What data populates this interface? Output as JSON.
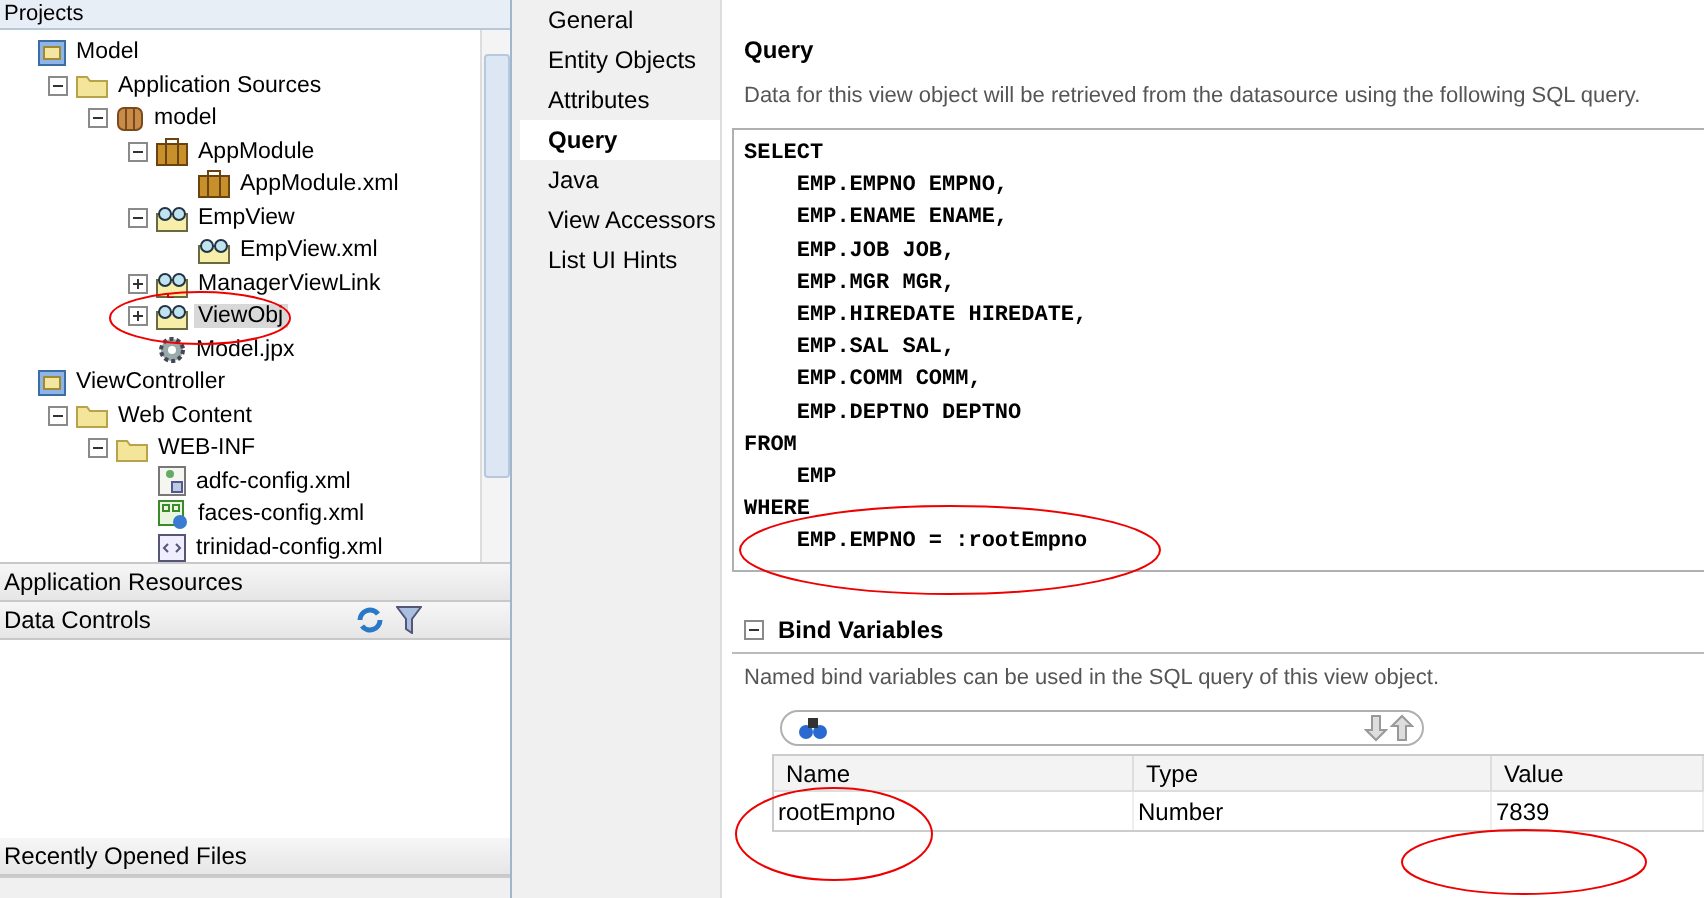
{
  "projects_panel": {
    "title": "Projects",
    "tree": [
      {
        "label": "Model",
        "kind": "project",
        "children": [
          {
            "label": "Application Sources",
            "kind": "folder",
            "expanded": true,
            "children": [
              {
                "label": "model",
                "kind": "package",
                "expanded": true,
                "children": [
                  {
                    "label": "AppModule",
                    "kind": "module",
                    "expanded": true,
                    "children": [
                      {
                        "label": "AppModule.xml",
                        "kind": "module"
                      }
                    ]
                  },
                  {
                    "label": "EmpView",
                    "kind": "view",
                    "expanded": true,
                    "children": [
                      {
                        "label": "EmpView.xml",
                        "kind": "view"
                      }
                    ]
                  },
                  {
                    "label": "ManagerViewLink",
                    "kind": "link",
                    "expanded": false
                  },
                  {
                    "label": "ViewObj",
                    "kind": "view",
                    "expanded": false,
                    "selected": true
                  },
                  {
                    "label": "Model.jpx",
                    "kind": "jpx"
                  }
                ]
              }
            ]
          }
        ]
      },
      {
        "label": "ViewController",
        "kind": "project",
        "children": [
          {
            "label": "Web Content",
            "kind": "folder",
            "expanded": true,
            "children": [
              {
                "label": "WEB-INF",
                "kind": "folder",
                "expanded": true,
                "children": [
                  {
                    "label": "adfc-config.xml",
                    "kind": "config"
                  },
                  {
                    "label": "faces-config.xml",
                    "kind": "faces"
                  },
                  {
                    "label": "trinidad-config.xml",
                    "kind": "xml"
                  }
                ]
              }
            ]
          }
        ]
      }
    ]
  },
  "accordion": [
    "Application Resources",
    "Data Controls",
    "Recently Opened Files"
  ],
  "nav": [
    {
      "label": "General",
      "selected": false
    },
    {
      "label": "Entity Objects",
      "selected": false
    },
    {
      "label": "Attributes",
      "selected": false
    },
    {
      "label": "Query",
      "selected": true
    },
    {
      "label": "Java",
      "selected": false
    },
    {
      "label": "View Accessors",
      "selected": false
    },
    {
      "label": "List UI Hints",
      "selected": false
    }
  ],
  "query": {
    "title": "Query",
    "description": "Data for this view object will be retrieved from the datasource using the following SQL query.",
    "sql": [
      "SELECT",
      "    EMP.EMPNO EMPNO,",
      "    EMP.ENAME ENAME,",
      "    EMP.JOB JOB,",
      "    EMP.MGR MGR,",
      "    EMP.HIREDATE HIREDATE,",
      "    EMP.SAL SAL,",
      "    EMP.COMM COMM,",
      "    EMP.DEPTNO DEPTNO",
      "FROM",
      "    EMP",
      "WHERE",
      "    EMP.EMPNO = :rootEmpno"
    ]
  },
  "bind_variables": {
    "title": "Bind Variables",
    "expanded": true,
    "description": "Named bind variables can be used in the SQL query of this view object.",
    "columns": [
      "Name",
      "Type",
      "Value"
    ],
    "rows": [
      [
        "rootEmpno",
        "Number",
        "7839"
      ]
    ]
  }
}
